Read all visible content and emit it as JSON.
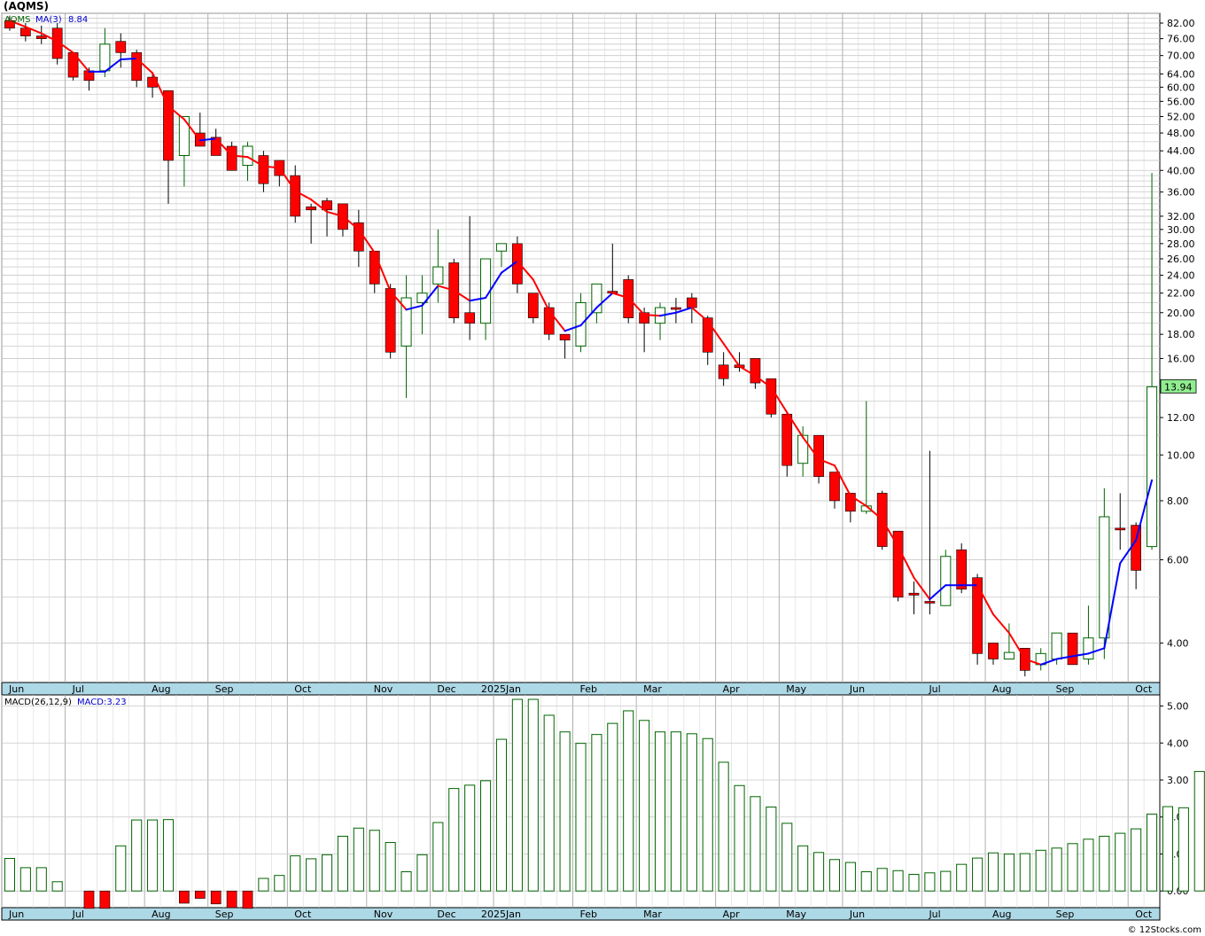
{
  "title": "(AQMS)",
  "footer": "© 12Stocks.com",
  "colors": {
    "up": "#006400",
    "down": "#ff0000",
    "ma_up": "#0000ff",
    "ma_down": "#ff0000",
    "macd": "#006400",
    "axis_band": "#add8e6",
    "price_box": "#90ee90"
  },
  "legend": {
    "symbol": "AQMS",
    "ma_label": "MA(3)",
    "ma_value": "8.84",
    "macd_label": "MACD(26,12,9)",
    "macd_value": "MACD:3.23"
  },
  "last_price_label": "13.94",
  "month_labels": [
    "Jun",
    "Jul",
    "Aug",
    "Sep",
    "Oct",
    "Nov",
    "Dec",
    "2025Jan",
    "Feb",
    "Mar",
    "Apr",
    "May",
    "Jun",
    "Jul",
    "Aug",
    "Sep",
    "Oct"
  ],
  "chart_data": [
    {
      "type": "candlestick",
      "scale": "log",
      "symbol": "AQMS",
      "y_ticks": [
        "82.00",
        "76.00",
        "70.00",
        "64.00",
        "60.00",
        "56.00",
        "52.00",
        "48.00",
        "44.00",
        "40.00",
        "36.00",
        "32.00",
        "30.00",
        "28.00",
        "26.00",
        "24.00",
        "22.00",
        "20.00",
        "18.00",
        "16.00",
        "14.00",
        "12.00",
        "10.00",
        "8.00",
        "6.00",
        "4.00"
      ],
      "ylim": [
        3.3,
        86
      ],
      "months": [
        "Jun",
        "Jul",
        "Aug",
        "Sep",
        "Oct",
        "Nov",
        "Dec",
        "2025Jan",
        "Feb",
        "Mar",
        "Apr",
        "May",
        "Jun",
        "Jul",
        "Aug",
        "Sep",
        "Oct"
      ],
      "month_week_index": [
        0,
        4,
        9,
        13,
        18,
        23,
        27,
        31,
        36,
        40,
        45,
        49,
        53,
        58,
        62,
        66,
        71
      ],
      "weeks": 73,
      "ohlc": [
        [
          83,
          85,
          79,
          80
        ],
        [
          80,
          82,
          75,
          77
        ],
        [
          77,
          81,
          74,
          76
        ],
        [
          80,
          82,
          67,
          69
        ],
        [
          71,
          71,
          62,
          63
        ],
        [
          65,
          66,
          59,
          62
        ],
        [
          65,
          80,
          63,
          74
        ],
        [
          75,
          78,
          66,
          71
        ],
        [
          71,
          72,
          60,
          62
        ],
        [
          63,
          64,
          57,
          60
        ],
        [
          59,
          59,
          34,
          42
        ],
        [
          43,
          52,
          37,
          52
        ],
        [
          48,
          53,
          45,
          45
        ],
        [
          47,
          49,
          43,
          43
        ],
        [
          45,
          46,
          40,
          40
        ],
        [
          41,
          46,
          38,
          45
        ],
        [
          43,
          44,
          36,
          37.5
        ],
        [
          42,
          42,
          37,
          39
        ],
        [
          39,
          41,
          31,
          32
        ],
        [
          33.5,
          34,
          28,
          33
        ],
        [
          34.5,
          35,
          29,
          33
        ],
        [
          34,
          34,
          29,
          30
        ],
        [
          31,
          33,
          25,
          27
        ],
        [
          27,
          27,
          22,
          23
        ],
        [
          22.5,
          23,
          16,
          16.5
        ],
        [
          17,
          24,
          13.2,
          21.5
        ],
        [
          21,
          24,
          18,
          22
        ],
        [
          23,
          30,
          21,
          25
        ],
        [
          25.5,
          26,
          19,
          19.5
        ],
        [
          20,
          32,
          17.5,
          19
        ],
        [
          19,
          26,
          17.5,
          26
        ],
        [
          27,
          28,
          25,
          28
        ],
        [
          28,
          29,
          22,
          23
        ],
        [
          22,
          22,
          19,
          19.5
        ],
        [
          20.5,
          21,
          17.5,
          18
        ],
        [
          18,
          18,
          16,
          17.5
        ],
        [
          17,
          22,
          16.5,
          21
        ],
        [
          20,
          23,
          19,
          23
        ],
        [
          22.2,
          28,
          22,
          22
        ],
        [
          23.5,
          24,
          19,
          19.5
        ],
        [
          20,
          20.5,
          16.5,
          19
        ],
        [
          19,
          21,
          17.5,
          20.5
        ],
        [
          20.5,
          21.5,
          19,
          20.5
        ],
        [
          21.5,
          22,
          19,
          20.5
        ],
        [
          19.5,
          19.7,
          15.5,
          16.5
        ],
        [
          15.5,
          16.5,
          14,
          14.5
        ],
        [
          15.5,
          16.5,
          15,
          15.3
        ],
        [
          16,
          16,
          13.8,
          14.2
        ],
        [
          14.5,
          14.5,
          12,
          12.2
        ],
        [
          12.2,
          12.3,
          9,
          9.5
        ],
        [
          9.6,
          11.5,
          9,
          11
        ],
        [
          11,
          11,
          8.7,
          9
        ],
        [
          9.2,
          9.2,
          7.7,
          8
        ],
        [
          8.3,
          8.3,
          7.2,
          7.6
        ],
        [
          7.6,
          13,
          7.5,
          7.8
        ],
        [
          8.3,
          8.4,
          6.3,
          6.4
        ],
        [
          6.9,
          6.9,
          4.9,
          5
        ],
        [
          5.1,
          5.4,
          4.6,
          5.05
        ],
        [
          4.9,
          10.2,
          4.6,
          4.9
        ],
        [
          4.8,
          6.3,
          4.8,
          6.1
        ],
        [
          6.3,
          6.5,
          5.1,
          5.2
        ],
        [
          5.5,
          5.6,
          3.6,
          3.8
        ],
        [
          4,
          4,
          3.6,
          3.7
        ],
        [
          3.7,
          4.4,
          3.7,
          3.82
        ],
        [
          3.9,
          3.9,
          3.4,
          3.5
        ],
        [
          3.6,
          3.9,
          3.5,
          3.8
        ],
        [
          3.7,
          4.2,
          3.6,
          4.2
        ],
        [
          4.2,
          4.2,
          3.6,
          3.6
        ],
        [
          3.7,
          4.8,
          3.6,
          4.1
        ],
        [
          4.1,
          8.5,
          3.7,
          7.4
        ],
        [
          7,
          8.3,
          6.3,
          7
        ],
        [
          7.1,
          7.2,
          5.2,
          5.7
        ],
        [
          6.4,
          39.5,
          6.3,
          13.94
        ]
      ],
      "ma3": [
        83,
        80.5,
        78,
        75,
        71,
        64.7,
        64.7,
        68.7,
        69,
        64.3,
        54.7,
        51.3,
        46.3,
        46.7,
        43,
        42.7,
        40.8,
        40.5,
        36.2,
        34.7,
        32.7,
        32,
        30,
        26.8,
        22.2,
        20.3,
        20.7,
        22.8,
        22.3,
        21.2,
        21.5,
        24.3,
        25.7,
        23.5,
        20.2,
        18.3,
        18.8,
        20.5,
        22,
        21.5,
        19.8,
        19.7,
        20,
        20.5,
        19.2,
        17.2,
        15.4,
        14.7,
        13.9,
        12.3,
        10.9,
        9.8,
        9.5,
        8.2,
        7.8,
        7.3,
        6.4,
        5.5,
        4.95,
        5.3,
        5.3,
        5.3,
        4.6,
        4.2,
        3.7,
        3.6,
        3.7,
        3.75,
        3.8,
        3.9,
        5.9,
        6.6,
        8.84
      ],
      "ma_color": "red when falling, blue when rising",
      "last_close": 13.94
    },
    {
      "type": "bar",
      "name": "MACD(26,12,9)",
      "last_value": 3.23,
      "y_ticks": [
        "5.00",
        "4.00",
        "3.00",
        "2.00",
        "1.00",
        "0.00"
      ],
      "ylim": [
        -0.45,
        5.3
      ],
      "values": [
        0.88,
        0.63,
        0.63,
        0.25,
        null,
        -0.47,
        -0.47,
        1.22,
        1.92,
        1.92,
        1.93,
        -0.33,
        -0.2,
        -0.35,
        -0.45,
        -0.47,
        0.34,
        0.42,
        0.95,
        0.87,
        0.98,
        1.48,
        1.7,
        1.64,
        1.31,
        0.52,
        0.98,
        1.85,
        2.77,
        2.86,
        2.98,
        4.1,
        5.18,
        5.18,
        4.75,
        4.3,
        3.99,
        4.23,
        4.53,
        4.87,
        4.61,
        4.3,
        4.3,
        4.25,
        4.12,
        3.48,
        2.85,
        2.55,
        2.27,
        1.83,
        1.22,
        1.04,
        0.85,
        0.77,
        0.52,
        0.61,
        0.55,
        0.45,
        0.49,
        0.53,
        0.72,
        0.89,
        1.03,
        1.0,
        1.01,
        1.1,
        1.16,
        1.28,
        1.4,
        1.48,
        1.56,
        1.68,
        2.08,
        2.28,
        2.25,
        3.23
      ]
    }
  ]
}
